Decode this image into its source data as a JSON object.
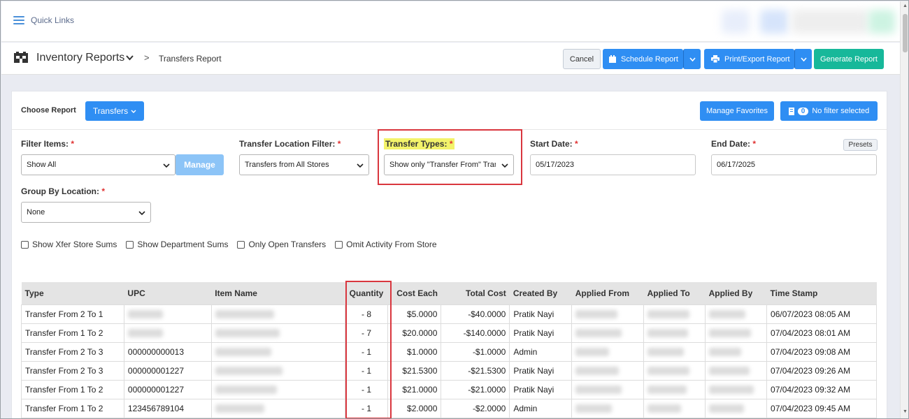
{
  "topbar": {
    "quick_links": "Quick Links"
  },
  "header": {
    "title": "Inventory Reports",
    "caret": "⌄",
    "separator": ">",
    "breadcrumb": "Transfers Report",
    "cancel": "Cancel",
    "schedule": "Schedule Report",
    "print": "Print/Export Report",
    "generate": "Generate Report"
  },
  "report": {
    "choose_label": "Choose Report",
    "selected": "Transfers",
    "manage_favorites": "Manage Favorites",
    "filter_count": "0",
    "filter_status": "No filter selected"
  },
  "filters": {
    "filter_items_label": "Filter Items:",
    "filter_items_value": "Show All",
    "manage": "Manage",
    "location_label": "Transfer Location Filter:",
    "location_value": "Transfers from All Stores",
    "types_label": "Transfer Types:",
    "types_value": "Show only \"Transfer From\" Tran",
    "start_label": "Start Date:",
    "start_value": "05/17/2023",
    "end_label": "End Date:",
    "end_value": "06/17/2025",
    "presets": "Presets",
    "group_label": "Group By Location:",
    "group_value": "None",
    "required_mark": "*"
  },
  "checkboxes": [
    {
      "label": "Show Xfer Store Sums",
      "checked": false
    },
    {
      "label": "Show Department Sums",
      "checked": false
    },
    {
      "label": "Only Open Transfers",
      "checked": false
    },
    {
      "label": "Omit Activity From Store",
      "checked": false
    }
  ],
  "table": {
    "columns": [
      "Type",
      "UPC",
      "Item Name",
      "Quantity",
      "Cost Each",
      "Total Cost",
      "Created By",
      "Applied From",
      "Applied To",
      "Applied By",
      "Time Stamp"
    ],
    "rows": [
      {
        "type": "Transfer From 2 To 1",
        "upc": "",
        "qty": "- 8",
        "cost": "$5.0000",
        "total": "-$40.0000",
        "created": "Pratik Nayi",
        "time": "06/07/2023 08:05 AM"
      },
      {
        "type": "Transfer From 1 To 2",
        "upc": "",
        "qty": "- 7",
        "cost": "$20.0000",
        "total": "-$140.0000",
        "created": "Pratik Nayi",
        "time": "07/04/2023 08:01 AM"
      },
      {
        "type": "Transfer From 2 To 3",
        "upc": "000000000013",
        "qty": "- 1",
        "cost": "$1.0000",
        "total": "-$1.0000",
        "created": "Admin",
        "time": "07/04/2023 09:08 AM"
      },
      {
        "type": "Transfer From 2 To 3",
        "upc": "000000001227",
        "qty": "- 1",
        "cost": "$21.5300",
        "total": "-$21.5300",
        "created": "Pratik Nayi",
        "time": "07/04/2023 09:26 AM"
      },
      {
        "type": "Transfer From 1 To 2",
        "upc": "000000001227",
        "qty": "- 1",
        "cost": "$21.0000",
        "total": "-$21.0000",
        "created": "Pratik Nayi",
        "time": "07/04/2023 09:32 AM"
      },
      {
        "type": "Transfer From 1 To 2",
        "upc": "123456789104",
        "qty": "- 1",
        "cost": "$2.0000",
        "total": "-$2.0000",
        "created": "Admin",
        "time": "07/04/2023 09:45 AM"
      }
    ]
  },
  "colors": {
    "primary": "#2f8ef3",
    "success": "#17b89a",
    "highlight_box": "#d9363e",
    "label_highlight": "#f3f36a"
  },
  "icons": [
    "menu-icon",
    "warehouse-icon",
    "calendar-icon",
    "printer-icon",
    "filter-icon",
    "chevron-down-icon"
  ]
}
